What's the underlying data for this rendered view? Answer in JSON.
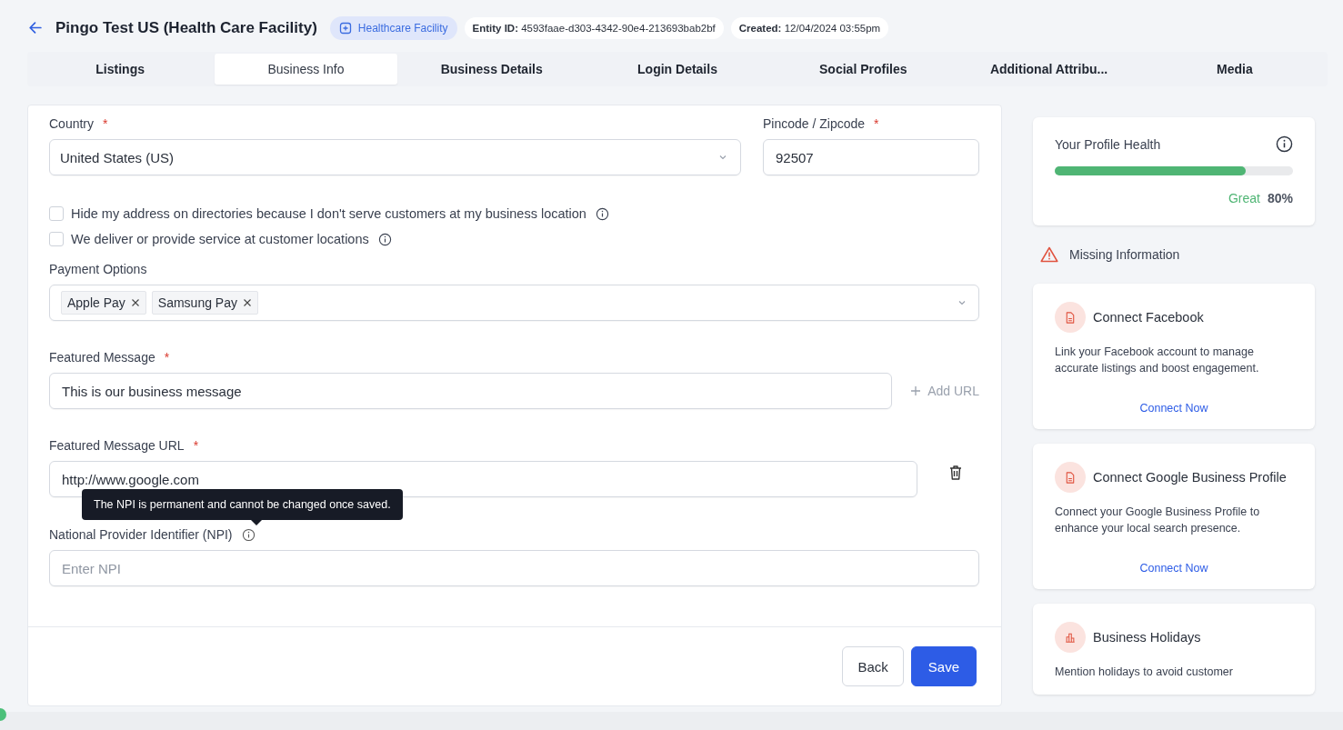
{
  "header": {
    "title": "Pingo Test US (Health Care Facility)",
    "badge": "Healthcare Facility",
    "meta": [
      {
        "label": "Entity ID:",
        "value": "4593faae-d303-4342-90e4-213693bab2bf"
      },
      {
        "label": "Created:",
        "value": "12/04/2024 03:55pm"
      }
    ]
  },
  "tabs": [
    {
      "label": "Listings",
      "selected": false
    },
    {
      "label": "Business Info",
      "selected": true
    },
    {
      "label": "Business Details",
      "selected": false
    },
    {
      "label": "Login Details",
      "selected": false
    },
    {
      "label": "Social Profiles",
      "selected": false
    },
    {
      "label": "Additional Attribu...",
      "selected": false
    },
    {
      "label": "Media",
      "selected": false
    }
  ],
  "form": {
    "country": {
      "label": "Country",
      "required_mark": "*",
      "value": "United States (US)"
    },
    "pincode": {
      "label": "Pincode / Zipcode",
      "required_mark": "*",
      "value": "92507"
    },
    "checkboxes": [
      {
        "label": "Hide my address on directories because I don't serve customers at my business location",
        "checked": false
      },
      {
        "label": "We deliver or provide service at customer locations",
        "checked": false
      }
    ],
    "payment": {
      "label": "Payment Options",
      "tags": [
        "Apple Pay",
        "Samsung Pay"
      ]
    },
    "featured_message": {
      "label": "Featured Message",
      "required_mark": "*",
      "value": "This is our business message",
      "add_url": "Add URL"
    },
    "featured_url": {
      "label": "Featured Message URL",
      "required_mark": "*",
      "value": "http://www.google.com"
    },
    "npi": {
      "label": "National Provider Identifier (NPI)",
      "placeholder": "Enter NPI",
      "tooltip": "The NPI is permanent and cannot be changed once saved."
    },
    "buttons": [
      {
        "label": "Back",
        "kind": "secondary"
      },
      {
        "label": "Save",
        "kind": "primary"
      }
    ]
  },
  "sidebar": {
    "health": {
      "title": "Your Profile Health",
      "level": 0.8,
      "rating": "Great",
      "percent": "80%"
    },
    "missing_title": "Missing Information",
    "cards": [
      {
        "kind": "document",
        "title": "Connect Facebook",
        "description": "Link your Facebook account to manage accurate listings and boost engagement.",
        "action": "Connect Now"
      },
      {
        "kind": "document",
        "title": "Connect Google Business Profile",
        "description": "Connect your Google Business Profile to enhance your local search presence.",
        "action": "Connect Now"
      },
      {
        "kind": "chart",
        "title": "Business Holidays",
        "description": "Mention holidays to avoid customer"
      }
    ]
  }
}
